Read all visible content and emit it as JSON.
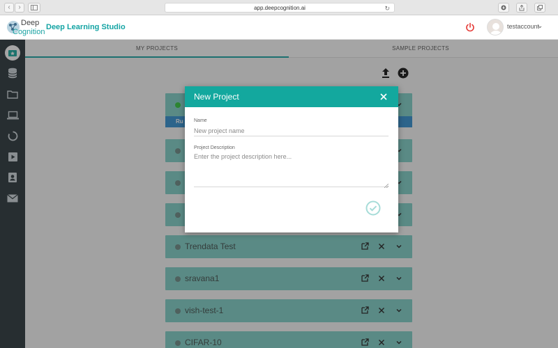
{
  "browser": {
    "url": "app.deepcognition.ai",
    "nav_back_glyph": "‹",
    "nav_forward_glyph": "›"
  },
  "header": {
    "logo_line1": "Deep",
    "logo_line2": "Cognition",
    "brand": "Deep Learning Studio",
    "username": "testaccount",
    "user_menu_glyph": "⌄"
  },
  "tabs": [
    {
      "label": "MY PROJECTS",
      "active": true
    },
    {
      "label": "SAMPLE PROJECTS",
      "active": false
    }
  ],
  "sidebar": {
    "icons": [
      "project-star-icon",
      "database-icon",
      "folder-icon",
      "laptop-icon",
      "loading-circle-icon",
      "video-icon",
      "contacts-icon",
      "mail-icon"
    ]
  },
  "projects": [
    {
      "name": "",
      "status": "online",
      "strip_text": "Ru"
    },
    {
      "name": "",
      "status": "offline"
    },
    {
      "name": "",
      "status": "offline"
    },
    {
      "name": "",
      "status": "offline"
    },
    {
      "name": "Trendata Test",
      "status": "offline"
    },
    {
      "name": "sravana1",
      "status": "offline"
    },
    {
      "name": "vish-test-1",
      "status": "offline"
    },
    {
      "name": "CIFAR-10",
      "status": "offline"
    }
  ],
  "modal": {
    "title": "New Project",
    "name_label": "Name",
    "name_placeholder": "New project name",
    "name_value": "",
    "desc_label": "Project Description",
    "desc_placeholder": "Enter the project description here...",
    "desc_value": ""
  },
  "colors": {
    "accent": "#13a89e",
    "sidebar_bg": "#263238",
    "row_bg": "#7fd1c8",
    "online": "#30c83a",
    "run_strip": "#2f8fd2",
    "power": "#e53935"
  }
}
